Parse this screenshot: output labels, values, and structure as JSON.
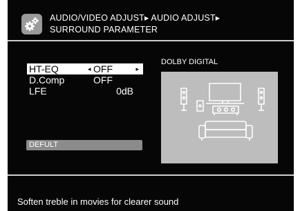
{
  "header": {
    "breadcrumb_line1": "AUDIO/VIDEO ADJUST▸ AUDIO ADJUST▸",
    "breadcrumb_line2": "SURROUND PARAMETER"
  },
  "settings": {
    "items": [
      {
        "label": "HT-EQ",
        "value": "OFF",
        "selected": true
      },
      {
        "label": "D.Comp",
        "value": "OFF",
        "selected": false
      },
      {
        "label": "LFE",
        "value": "0dB",
        "selected": false
      }
    ],
    "arrow_left": "◂",
    "arrow_right": "▸"
  },
  "default_button": {
    "label": "DEFULT"
  },
  "preview": {
    "format_label": "DOLBY DIGITAL"
  },
  "footer": {
    "help_text": "Soften treble in movies for clearer sound"
  },
  "colors": {
    "background": "#060606",
    "selection": "#ffffff",
    "panel": "#bdbdbd",
    "button": "#8b8b8b"
  },
  "icons": [
    "settings-gear-icon",
    "tv-icon",
    "speaker-icon",
    "subwoofer-icon",
    "sofa-icon"
  ]
}
